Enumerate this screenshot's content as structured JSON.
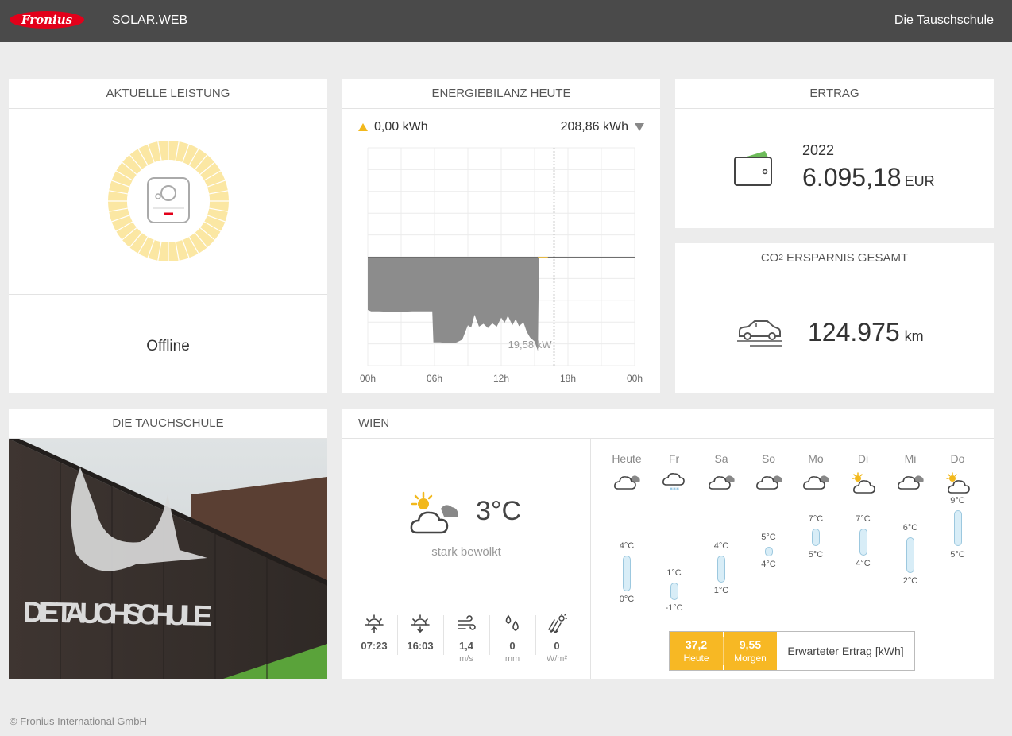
{
  "header": {
    "logo_text": "Fronius",
    "app_title": "SOLAR.WEB",
    "site_name": "Die Tauschschule"
  },
  "power": {
    "title": "AKTUELLE LEISTUNG",
    "status": "Offline"
  },
  "energy": {
    "title": "ENERGIEBILANZ HEUTE",
    "produced": "0,00 kWh",
    "consumed": "208,86 kWh",
    "marker_label": "19,58 kW",
    "x_ticks": [
      "00h",
      "06h",
      "12h",
      "18h",
      "00h"
    ],
    "colors": {
      "consumption": "#8c8c8c",
      "production": "#f2b81c"
    }
  },
  "chart_data": {
    "type": "area",
    "title": "ENERGIEBILANZ HEUTE",
    "xlabel": "",
    "ylabel": "",
    "x_unit": "h",
    "xlim": [
      0,
      24
    ],
    "series": [
      {
        "name": "",
        "x": [
          0,
          0.3,
          1,
          2,
          3,
          4,
          5,
          5.8,
          5.9,
          6.5,
          7,
          7.5,
          8,
          8.5,
          9,
          9.3,
          9.6,
          10,
          10.4,
          10.8,
          11.2,
          11.6,
          12,
          12.3,
          12.6,
          13,
          13.3,
          13.6,
          14,
          14.3,
          14.6,
          15,
          15.3,
          15.4
        ],
        "values": [
          -11,
          -11.3,
          -11.3,
          -11.4,
          -11.4,
          -11.3,
          -11.3,
          -11.3,
          -17.8,
          -17.8,
          -17.9,
          -18,
          -17.8,
          -17.2,
          -14.2,
          -14.7,
          -12,
          -14.5,
          -13.9,
          -14.8,
          -13.8,
          -14.5,
          -12.6,
          -13.7,
          -12.2,
          -14.2,
          -12.9,
          -14.4,
          -13.6,
          -15.6,
          -16.8,
          -17.6,
          -19.6,
          0
        ]
      }
    ],
    "annotations": [
      "19,58 kW"
    ]
  },
  "ertrag": {
    "title": "ERTRAG",
    "year": "2022",
    "value": "6.095,18",
    "unit": "EUR"
  },
  "co2": {
    "title_prefix": "CO",
    "title_sub": "2",
    "title_suffix": " ERSPARNIS GESAMT",
    "value": "124.975",
    "unit": "km"
  },
  "photo": {
    "title": "DIE TAUCHSCHULE",
    "wall_text": "DIE TAUCHSCHULE"
  },
  "weather": {
    "title": "WIEN",
    "current_temp": "3°C",
    "description": "stark bewölkt",
    "stats": [
      {
        "icon": "sunrise-icon",
        "value": "07:23",
        "unit": ""
      },
      {
        "icon": "sunset-icon",
        "value": "16:03",
        "unit": ""
      },
      {
        "icon": "wind-icon",
        "value": "1,4",
        "unit": "m/s"
      },
      {
        "icon": "rain-drops-icon",
        "value": "0",
        "unit": "mm"
      },
      {
        "icon": "radiation-icon",
        "value": "0",
        "unit": "W/m²"
      }
    ],
    "days": [
      {
        "name": "Heute",
        "icon": "cloudy-icon",
        "max": 4,
        "min": 0,
        "max_label": "4°C",
        "min_label": "0°C"
      },
      {
        "name": "Fr",
        "icon": "snow-icon",
        "max": 1,
        "min": -1,
        "max_label": "1°C",
        "min_label": "-1°C"
      },
      {
        "name": "Sa",
        "icon": "cloudy-icon",
        "max": 4,
        "min": 1,
        "max_label": "4°C",
        "min_label": "1°C"
      },
      {
        "name": "So",
        "icon": "cloudy-icon",
        "max": 5,
        "min": 4,
        "max_label": "5°C",
        "min_label": "4°C"
      },
      {
        "name": "Mo",
        "icon": "cloudy-icon",
        "max": 7,
        "min": 5,
        "max_label": "7°C",
        "min_label": "5°C"
      },
      {
        "name": "Di",
        "icon": "partly-sunny-icon",
        "max": 7,
        "min": 4,
        "max_label": "7°C",
        "min_label": "4°C"
      },
      {
        "name": "Mi",
        "icon": "cloudy-icon",
        "max": 6,
        "min": 2,
        "max_label": "6°C",
        "min_label": "2°C"
      },
      {
        "name": "Do",
        "icon": "partly-sunny-icon",
        "max": 9,
        "min": 5,
        "max_label": "9°C",
        "min_label": "5°C"
      }
    ],
    "forecast": {
      "today_value": "37,2",
      "today_label": "Heute",
      "tomorrow_value": "9,55",
      "tomorrow_label": "Morgen",
      "caption": "Erwarteter Ertrag [kWh]"
    }
  },
  "footer": {
    "copyright": "© Fronius International GmbH"
  }
}
